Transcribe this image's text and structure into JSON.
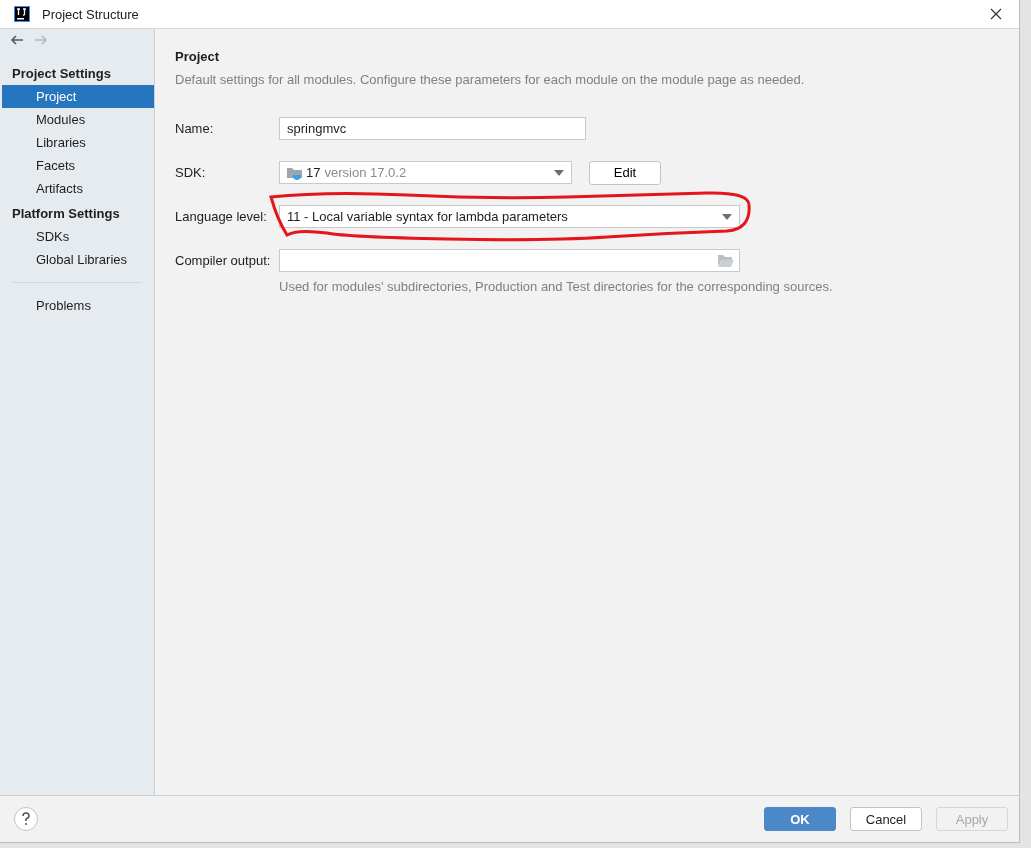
{
  "window": {
    "title": "Project Structure"
  },
  "navigation": [
    {
      "kind": "back",
      "disabled": false
    },
    {
      "kind": "forward",
      "disabled": true
    }
  ],
  "sidebar": {
    "sections": [
      {
        "title": "Project Settings",
        "items": [
          {
            "label": "Project",
            "selected": true
          },
          {
            "label": "Modules",
            "selected": false
          },
          {
            "label": "Libraries",
            "selected": false
          },
          {
            "label": "Facets",
            "selected": false
          },
          {
            "label": "Artifacts",
            "selected": false
          }
        ]
      },
      {
        "title": "Platform Settings",
        "items": [
          {
            "label": "SDKs",
            "selected": false
          },
          {
            "label": "Global Libraries",
            "selected": false
          }
        ]
      },
      {
        "items": [
          {
            "label": "Problems",
            "selected": false
          }
        ]
      }
    ]
  },
  "content": {
    "title": "Project",
    "description": "Default settings for all modules. Configure these parameters for each module on the module page as needed.",
    "fields": [
      {
        "kind": "text",
        "label": "Name:",
        "value": "springmvc"
      },
      {
        "kind": "sdk",
        "label": "SDK:",
        "value": "17",
        "detail": "version 17.0.2",
        "button": "Edit"
      },
      {
        "kind": "dropdown",
        "label": "Language level:",
        "value": "11 - Local variable syntax for lambda parameters",
        "highlighted": true
      },
      {
        "kind": "path",
        "label": "Compiler output:",
        "value_hint": "Used for modules' subdirectories, Production and Test directories for the corresponding sources."
      }
    ]
  },
  "buttons": [
    {
      "label": "OK",
      "kind": "primary",
      "disabled": false
    },
    {
      "label": "Cancel",
      "kind": "normal",
      "disabled": false
    },
    {
      "label": "Apply",
      "kind": "normal",
      "disabled": true
    }
  ]
}
